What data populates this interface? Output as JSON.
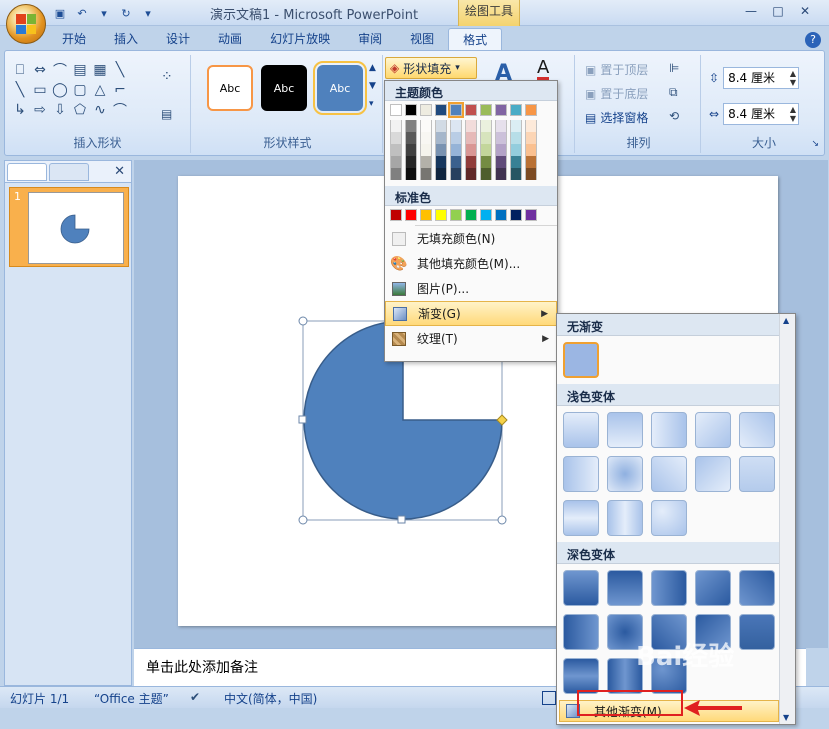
{
  "window": {
    "title": "演示文稿1 - Microsoft PowerPoint",
    "context_tab": "绘图工具",
    "controls": [
      "—",
      "□",
      "✕"
    ]
  },
  "tabs": [
    "开始",
    "插入",
    "设计",
    "动画",
    "幻灯片放映",
    "审阅",
    "视图",
    "格式"
  ],
  "active_tab": "格式",
  "ribbon": {
    "groups": {
      "insert_shapes": "插入形状",
      "shape_styles": "形状样式",
      "arrange": "排列",
      "size": "大小"
    },
    "style_samples": [
      "Abc",
      "Abc",
      "Abc"
    ],
    "shape_fill_label": "形状填充",
    "arrange_items": [
      "置于顶层",
      "置于底层",
      "选择窗格"
    ],
    "height_value": "8.4 厘米",
    "width_value": "8.4 厘米"
  },
  "slide_panel": {
    "slide_number": "1"
  },
  "notes_placeholder": "单击此处添加备注",
  "status": {
    "slide": "幻灯片 1/1",
    "theme": "“Office 主题”",
    "language": "中文(简体，中国)"
  },
  "fill_menu": {
    "theme_colors_header": "主题颜色",
    "standard_colors_header": "标准色",
    "theme_colors": [
      "#ffffff",
      "#000000",
      "#eeece1",
      "#1f497d",
      "#4f81bd",
      "#c0504d",
      "#9bbb59",
      "#8064a2",
      "#4bacc6",
      "#f79646"
    ],
    "standard_colors": [
      "#c00000",
      "#ff0000",
      "#ffc000",
      "#ffff00",
      "#92d050",
      "#00b050",
      "#00b0f0",
      "#0070c0",
      "#002060",
      "#7030a0"
    ],
    "items": [
      {
        "label": "无填充颜色(N)",
        "icon": "no-fill-icon"
      },
      {
        "label": "其他填充颜色(M)...",
        "icon": "palette-icon"
      },
      {
        "label": "图片(P)...",
        "icon": "picture-icon"
      },
      {
        "label": "渐变(G)",
        "icon": "gradient-icon"
      },
      {
        "label": "纹理(T)",
        "icon": "texture-icon"
      }
    ]
  },
  "gradient_menu": {
    "no_gradient_header": "无渐变",
    "light_header": "浅色变体",
    "dark_header": "深色变体",
    "more_label": "其他渐变(M)..."
  },
  "watermark": "Bai经验"
}
